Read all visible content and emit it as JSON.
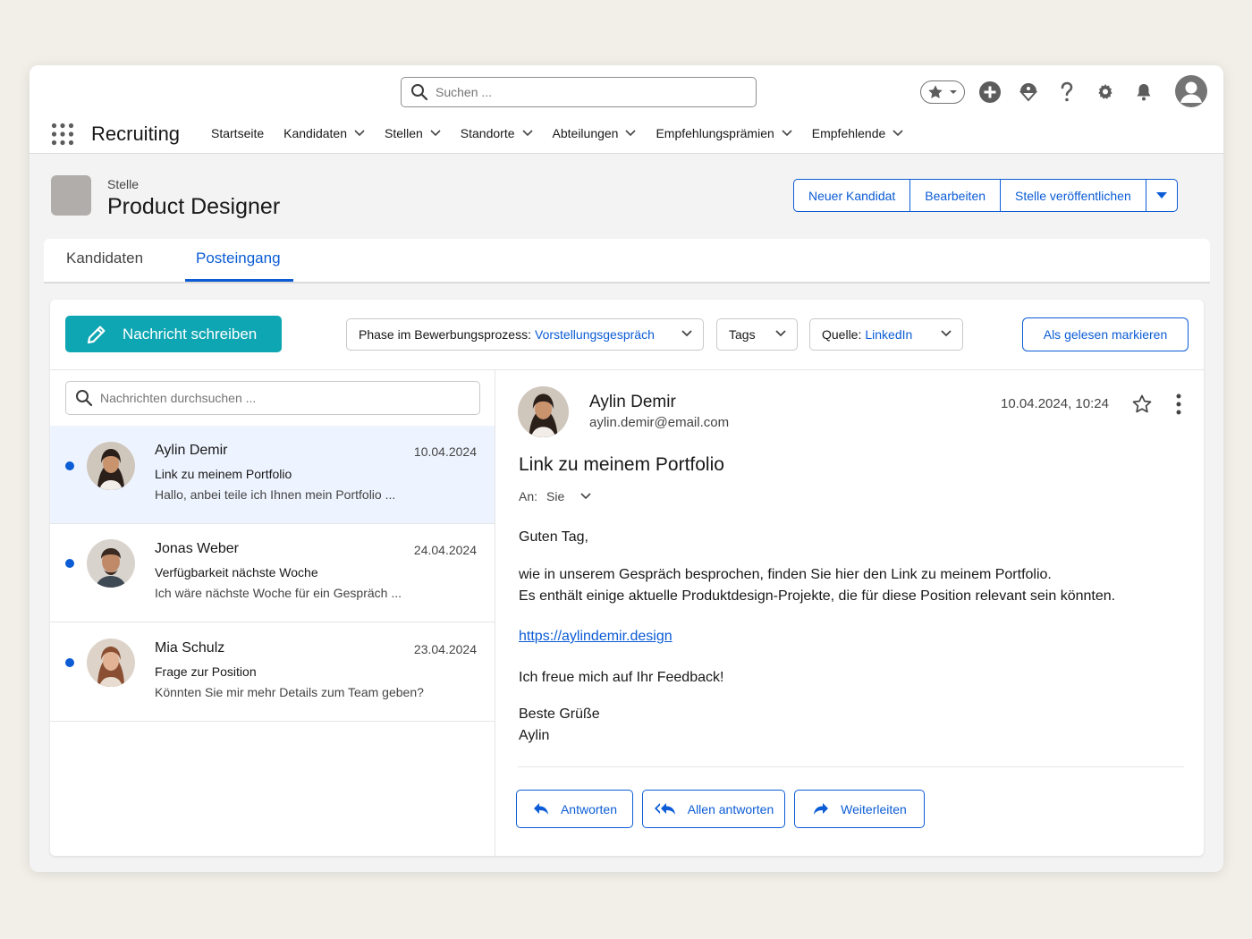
{
  "header": {
    "search_placeholder": "Suchen ...",
    "app_name": "Recruiting",
    "nav": [
      {
        "label": "Startseite",
        "has_menu": false
      },
      {
        "label": "Kandidaten",
        "has_menu": true
      },
      {
        "label": "Stellen",
        "has_menu": true
      },
      {
        "label": "Standorte",
        "has_menu": true
      },
      {
        "label": "Abteilungen",
        "has_menu": true
      },
      {
        "label": "Empfehlungsprämien",
        "has_menu": true
      },
      {
        "label": "Empfehlende",
        "has_menu": true
      }
    ],
    "icons": [
      "favorites-icon",
      "add-icon",
      "trailhead-icon",
      "help-icon",
      "settings-icon",
      "notifications-icon",
      "user-avatar"
    ]
  },
  "record": {
    "type_label": "Stelle",
    "title": "Product Designer",
    "actions": [
      "Neuer Kandidat",
      "Bearbeiten",
      "Stelle veröffentlichen"
    ]
  },
  "tabs": [
    {
      "label": "Kandidaten",
      "active": false
    },
    {
      "label": "Posteingang",
      "active": true
    }
  ],
  "toolbar": {
    "compose_label": "Nachricht schreiben",
    "phase_label": "Phase im Bewerbungsprozess:",
    "phase_value": "Vorstellungsgespräch",
    "tags_label": "Tags",
    "source_label": "Quelle:",
    "source_value": "LinkedIn",
    "mark_read_label": "Als gelesen markieren"
  },
  "list": {
    "search_placeholder": "Nachrichten durchsuchen ...",
    "messages": [
      {
        "name": "Aylin Demir",
        "date": "10.04.2024",
        "subject": "Link zu meinem Portfolio",
        "preview": "Hallo, anbei teile ich Ihnen mein Portfolio ...",
        "unread": true,
        "selected": true
      },
      {
        "name": "Jonas Weber",
        "date": "24.04.2024",
        "subject": "Verfügbarkeit nächste Woche",
        "preview": "Ich wäre nächste Woche für ein Gespräch ...",
        "unread": true,
        "selected": false
      },
      {
        "name": "Mia Schulz",
        "date": "23.04.2024",
        "subject": "Frage zur Position",
        "preview": "Könnten Sie mir mehr Details zum Team geben?",
        "unread": true,
        "selected": false
      }
    ]
  },
  "reading": {
    "sender_name": "Aylin Demir",
    "sender_email": "aylin.demir@email.com",
    "datetime": "10.04.2024, 10:24",
    "subject": "Link zu meinem Portfolio",
    "to_label": "An:",
    "to_value": "Sie",
    "greeting": "Guten Tag,",
    "line1": "wie in unserem Gespräch besprochen, finden Sie hier den Link zu meinem Portfolio.",
    "line2": "Es enthält einige aktuelle Produktdesign-Projekte, die für diese Position relevant sein könnten.",
    "link": "https://aylindemir.design",
    "closing": "Ich freue mich auf Ihr Feedback!",
    "regards": "Beste Grüße",
    "signature": "Aylin",
    "actions": [
      "Antworten",
      "Allen antworten",
      "Weiterleiten"
    ]
  },
  "colors": {
    "brand_blue": "#0b5cd5",
    "compose_teal": "#0fa6b3",
    "selected_row": "#eef4ff"
  }
}
